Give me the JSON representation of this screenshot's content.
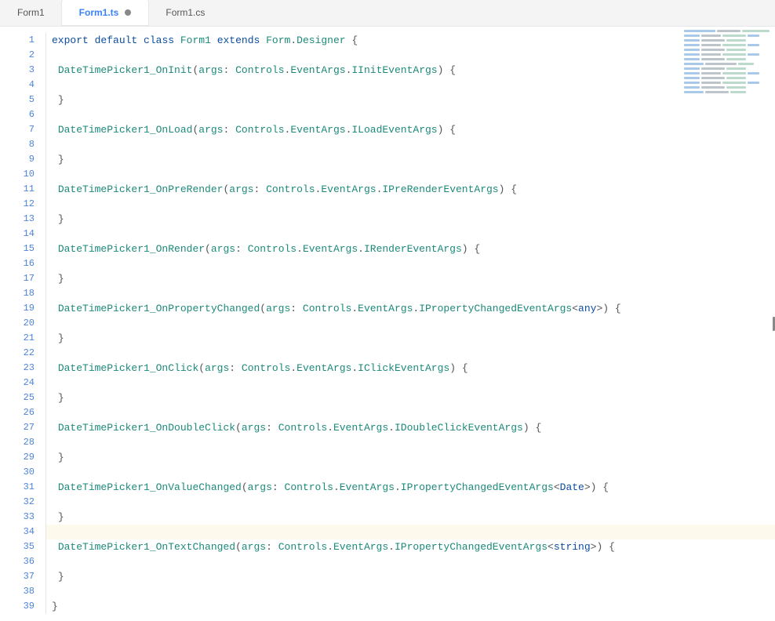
{
  "tabs": [
    {
      "label": "Form1",
      "active": false,
      "dirty": false
    },
    {
      "label": "Form1.ts",
      "active": true,
      "dirty": true
    },
    {
      "label": "Form1.cs",
      "active": false,
      "dirty": false
    }
  ],
  "editor": {
    "total_lines": 39,
    "current_line": 34,
    "tokens": {
      "kw_export": "export",
      "kw_default": "default",
      "kw_class": "class",
      "kw_extends": "extends",
      "cls_Form1": "Form1",
      "cls_Form": "Form",
      "cls_Designer": "Designer",
      "cls_Controls": "Controls",
      "cls_EventArgs": "EventArgs",
      "prm_args": "args",
      "t_any": "any",
      "t_Date": "Date",
      "t_string": "string",
      "brace_open": "{",
      "brace_close": "}",
      "lt": "<",
      "gt": ">",
      "paren_open": "(",
      "paren_close": ")",
      "colon": ":",
      "dot": "."
    },
    "methods": [
      {
        "name": "DateTimePicker1_OnInit",
        "argtype": "IInitEventArgs",
        "generic": null
      },
      {
        "name": "DateTimePicker1_OnLoad",
        "argtype": "ILoadEventArgs",
        "generic": null
      },
      {
        "name": "DateTimePicker1_OnPreRender",
        "argtype": "IPreRenderEventArgs",
        "generic": null
      },
      {
        "name": "DateTimePicker1_OnRender",
        "argtype": "IRenderEventArgs",
        "generic": null
      },
      {
        "name": "DateTimePicker1_OnPropertyChanged",
        "argtype": "IPropertyChangedEventArgs",
        "generic": "any"
      },
      {
        "name": "DateTimePicker1_OnClick",
        "argtype": "IClickEventArgs",
        "generic": null
      },
      {
        "name": "DateTimePicker1_OnDoubleClick",
        "argtype": "IDoubleClickEventArgs",
        "generic": null
      },
      {
        "name": "DateTimePicker1_OnValueChanged",
        "argtype": "IPropertyChangedEventArgs",
        "generic": "Date"
      },
      {
        "name": "DateTimePicker1_OnTextChanged",
        "argtype": "IPropertyChangedEventArgs",
        "generic": "string"
      }
    ]
  },
  "minimap_rows": [
    [
      40,
      30,
      35
    ],
    [
      20,
      25,
      30,
      15
    ],
    [
      20,
      30,
      25
    ],
    [
      20,
      25,
      30,
      15
    ],
    [
      20,
      30,
      25
    ],
    [
      20,
      25,
      30,
      15
    ],
    [
      20,
      30,
      25
    ],
    [
      25,
      40,
      20
    ],
    [
      20,
      30,
      25
    ],
    [
      20,
      25,
      30,
      15
    ],
    [
      20,
      30,
      25
    ],
    [
      20,
      25,
      30,
      15
    ],
    [
      20,
      30,
      25
    ],
    [
      25,
      30,
      20
    ]
  ]
}
